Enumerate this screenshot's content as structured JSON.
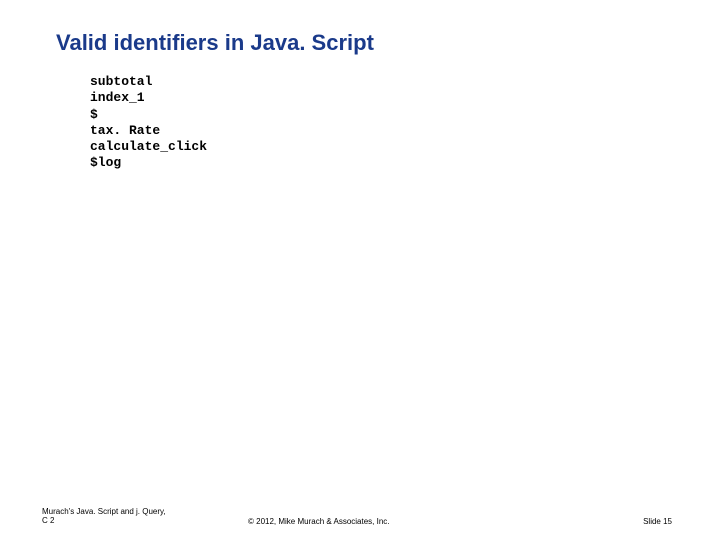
{
  "title": "Valid identifiers in Java. Script",
  "identifiers": [
    "subtotal",
    "index_1",
    "$",
    "tax. Rate",
    "calculate_click",
    "$log"
  ],
  "footer": {
    "left_line1": "Murach's Java. Script and j. Query,",
    "left_line2": "C 2",
    "center": "© 2012, Mike Murach & Associates, Inc.",
    "right": "Slide 15"
  }
}
